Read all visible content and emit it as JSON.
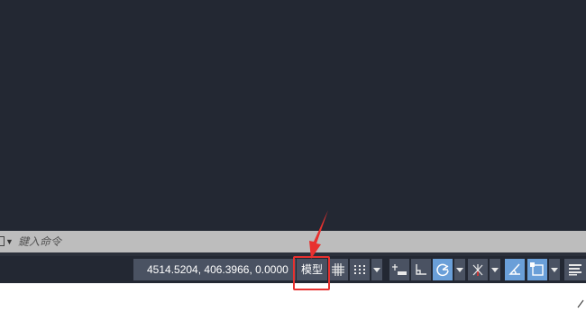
{
  "command_line": {
    "placeholder": "鍵入命令"
  },
  "status_bar": {
    "coordinates": "4514.5204, 406.3966, 0.0000",
    "model_tab_label": "模型",
    "buttons": [
      {
        "name": "grid-icon",
        "active": false
      },
      {
        "name": "snap-icon",
        "active": false
      },
      {
        "name": "infer-constraints-icon",
        "active": false
      },
      {
        "name": "ortho-icon",
        "active": false
      },
      {
        "name": "polar-tracking-icon",
        "active": true
      },
      {
        "name": "isodraft-icon",
        "active": false
      },
      {
        "name": "dynamic-ucs-icon",
        "active": true
      },
      {
        "name": "object-snap-icon",
        "active": true
      },
      {
        "name": "lineweight-icon",
        "active": false
      }
    ]
  },
  "colors": {
    "canvas": "#232833",
    "status_button": "#4a5262",
    "active_button": "#6a9fd8",
    "highlight": "#e8312f"
  }
}
